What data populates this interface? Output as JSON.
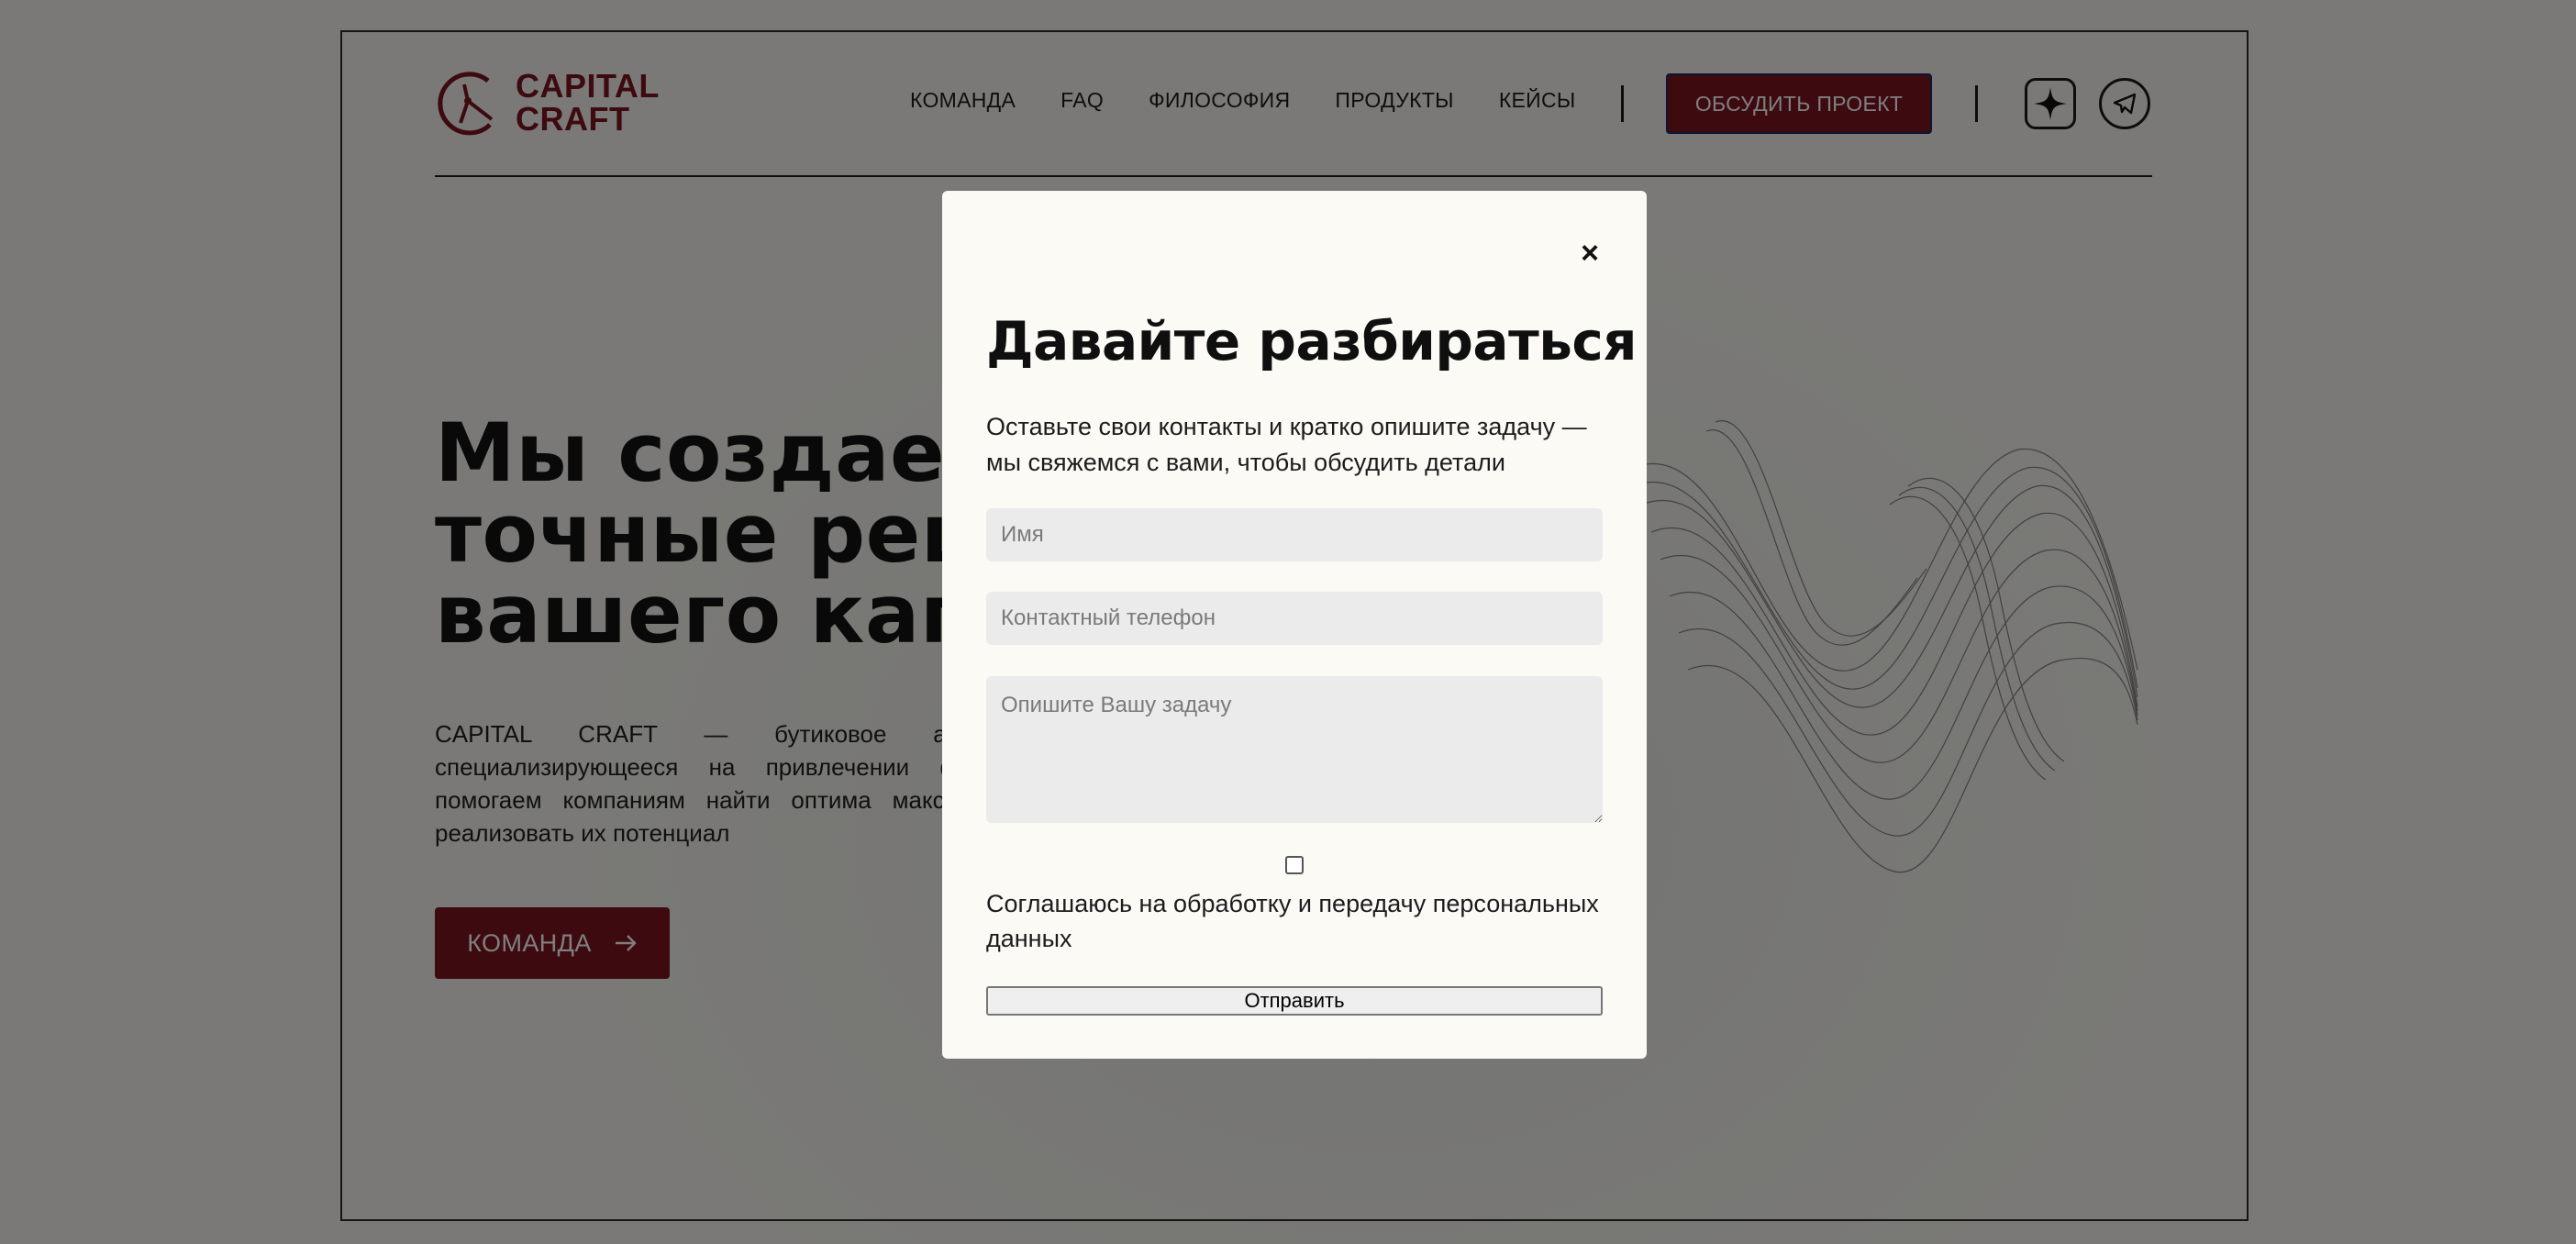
{
  "brand": {
    "line1": "CAPITAL",
    "line2": "CRAFT",
    "color": "#7b1420"
  },
  "nav": {
    "items": [
      {
        "label": "КОМАНДА"
      },
      {
        "label": "FAQ"
      },
      {
        "label": "ФИЛОСОФИЯ"
      },
      {
        "label": "ПРОДУКТЫ"
      },
      {
        "label": "КЕЙСЫ"
      }
    ],
    "cta_label": "ОБСУДИТЬ ПРОЕКТ",
    "icons": [
      "sparkle-icon",
      "telegram-icon"
    ]
  },
  "hero": {
    "title_lines": [
      "Мы создаем",
      "точные реше",
      "вашего капит"
    ],
    "description": "CAPITAL CRAFT — бутиковое агентство специализирующееся на привлечении фи Мы помогаем компаниям найти оптима максимально реализовать их потенциал",
    "button_label": "КОМАНДА",
    "button_icon": "arrow-right-icon"
  },
  "modal": {
    "close_glyph": "×",
    "title": "Давайте разбираться",
    "subtitle": "Оставьте свои контакты и кратко опишите задачу — мы свяжемся с вами, чтобы обсудить детали",
    "name_placeholder": "Имя",
    "phone_placeholder": "Контактный телефон",
    "task_placeholder": "Опишите Вашу задачу",
    "consent_label": "Соглашаюсь на обработку и передачу персональных данных",
    "consent_checked": false,
    "submit_label": "Отправить"
  },
  "colors": {
    "accent": "#7b1420",
    "overlay": "rgba(0,0,0,0.5)",
    "modal_bg": "#fbfaf5"
  }
}
